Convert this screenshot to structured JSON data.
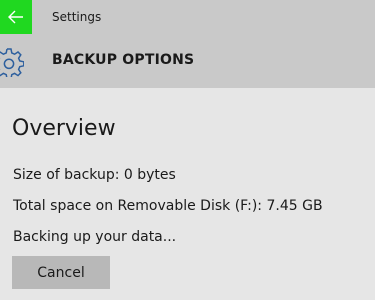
{
  "titlebar": {
    "back_icon": "arrow-left-icon",
    "app_title": "Settings",
    "highlight_color": "#20d820"
  },
  "header": {
    "icon": "gear-icon",
    "title": "BACKUP OPTIONS"
  },
  "overview": {
    "heading": "Overview",
    "size_line": "Size of backup: 0 bytes",
    "space_line": "Total space on Removable Disk (F:): 7.45 GB",
    "status_line": "Backing up your data...",
    "cancel_label": "Cancel"
  }
}
